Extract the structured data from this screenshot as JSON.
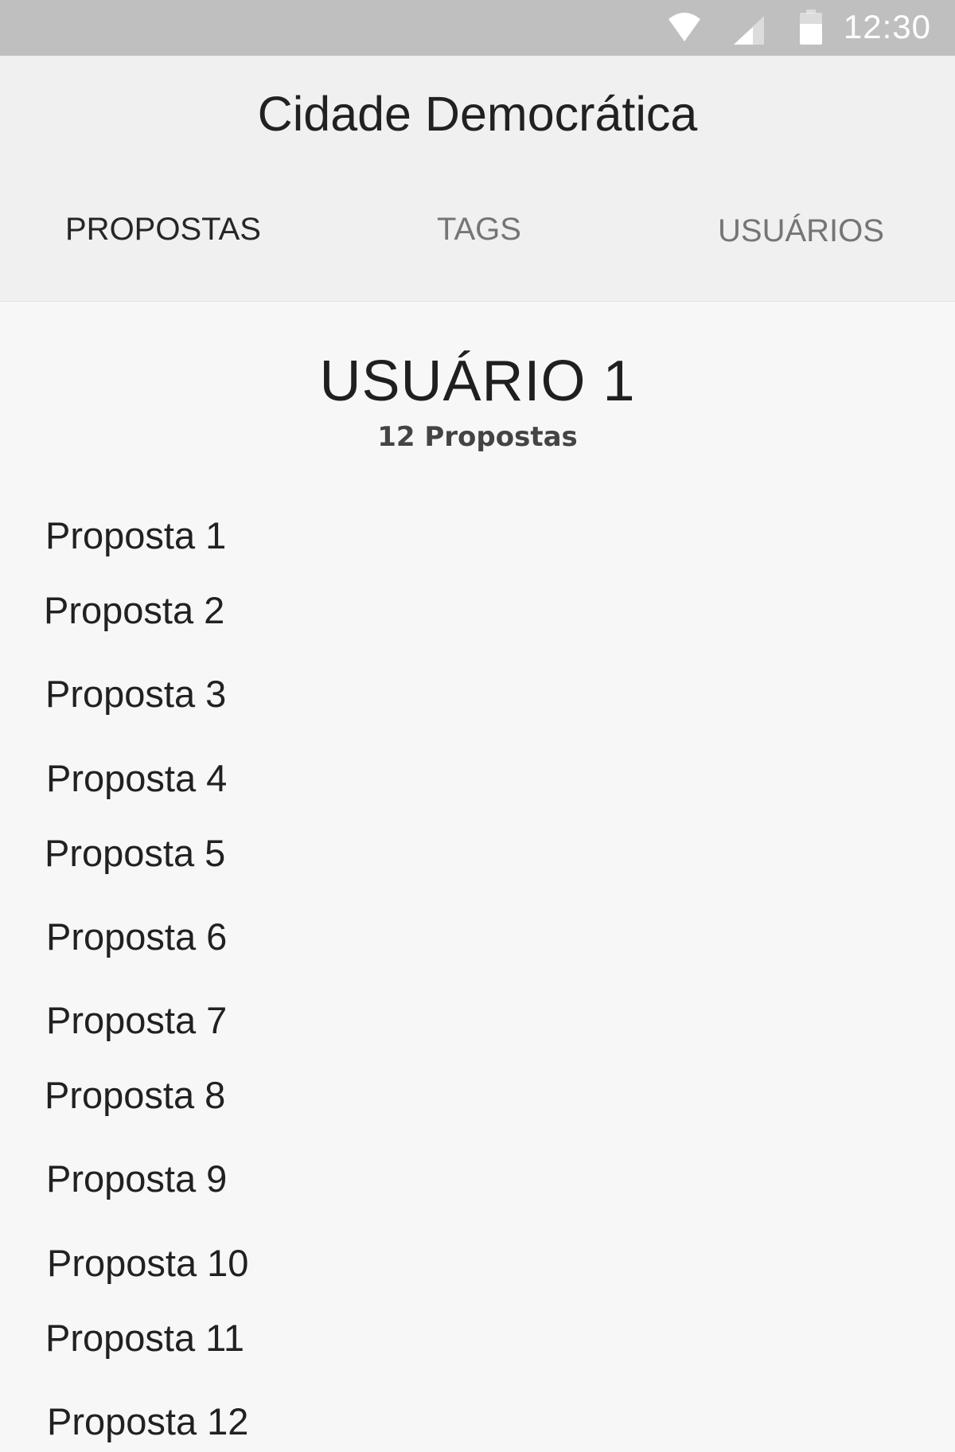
{
  "status_bar": {
    "time": "12:30",
    "icons": [
      "wifi-icon",
      "cell-signal-icon",
      "battery-icon"
    ]
  },
  "header": {
    "title": "Cidade Democrática"
  },
  "tabs": [
    {
      "label": "PROPOSTAS",
      "active": true
    },
    {
      "label": "TAGS",
      "active": false
    },
    {
      "label": "USUÁRIOS",
      "active": false
    }
  ],
  "profile": {
    "name": "USUÁRIO 1",
    "count": "12 Propostas"
  },
  "proposals": [
    "Proposta 1",
    "Proposta 2",
    "Proposta 3",
    "Proposta 4",
    "Proposta 5",
    "Proposta 6",
    "Proposta 7",
    "Proposta 8",
    "Proposta 9",
    "Proposta 10",
    "Proposta 11",
    "Proposta 12"
  ],
  "colors": {
    "status_bar": "#bfbfbf",
    "header_bg": "#f0f0f0",
    "page_bg": "#f7f7f7",
    "active_tab": "#262626",
    "inactive_tab": "#757575"
  }
}
